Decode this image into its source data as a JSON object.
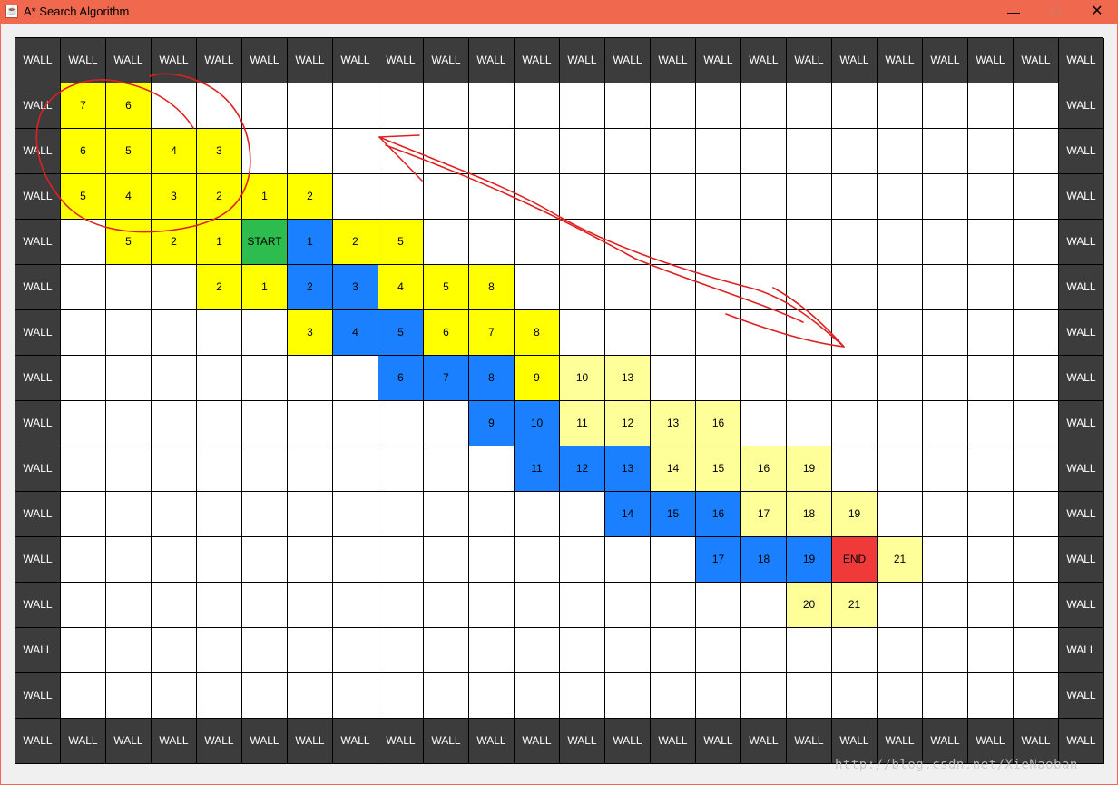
{
  "window": {
    "title": "A* Search Algorithm",
    "minimize_glyph": "—",
    "maximize_glyph": "☐",
    "close_glyph": "✕",
    "app_icon": "java-cup-icon"
  },
  "grid": {
    "cols": 24,
    "rows": 16,
    "wall_label": "WALL",
    "start_label": "START",
    "end_label": "END",
    "legend": {
      "W": "wall",
      "S": "start",
      "E": "end",
      "blue": "path",
      "bright-yellow": "closed",
      "pale-yellow": "open"
    },
    "colors": {
      "wall": "#3c3c3c",
      "empty": "#ffffff",
      "open": "#ffff99",
      "closed": "#ffff00",
      "path": "#1a80ff",
      "start": "#2dbd4e",
      "end": "#f03a3a",
      "annotation": "#e02020"
    },
    "cells": [
      [
        "W",
        "W",
        "W",
        "W",
        "W",
        "W",
        "W",
        "W",
        "W",
        "W",
        "W",
        "W",
        "W",
        "W",
        "W",
        "W",
        "W",
        "W",
        "W",
        "W",
        "W",
        "W",
        "W",
        "W"
      ],
      [
        "W",
        "c:7",
        "c:6",
        "",
        "",
        "",
        "",
        "",
        "",
        "",
        "",
        "",
        "",
        "",
        "",
        "",
        "",
        "",
        "",
        "",
        "",
        "",
        "",
        "W"
      ],
      [
        "W",
        "c:6",
        "c:5",
        "c:4",
        "c:3",
        "",
        "",
        "",
        "",
        "",
        "",
        "",
        "",
        "",
        "",
        "",
        "",
        "",
        "",
        "",
        "",
        "",
        "",
        "W"
      ],
      [
        "W",
        "c:5",
        "c:4",
        "c:3",
        "c:2",
        "c:1",
        "c:2",
        "",
        "",
        "",
        "",
        "",
        "",
        "",
        "",
        "",
        "",
        "",
        "",
        "",
        "",
        "",
        "",
        "W"
      ],
      [
        "W",
        "",
        "c:5",
        "c:2",
        "c:1",
        "S",
        "p:1",
        "c:2",
        "c:5",
        "",
        "",
        "",
        "",
        "",
        "",
        "",
        "",
        "",
        "",
        "",
        "",
        "",
        "",
        "W"
      ],
      [
        "W",
        "",
        "",
        "",
        "c:2",
        "c:1",
        "p:2",
        "p:3",
        "c:4",
        "c:5",
        "c:8",
        "",
        "",
        "",
        "",
        "",
        "",
        "",
        "",
        "",
        "",
        "",
        "",
        "W"
      ],
      [
        "W",
        "",
        "",
        "",
        "",
        "",
        "c:3",
        "p:4",
        "p:5",
        "c:6",
        "c:7",
        "c:8",
        "",
        "",
        "",
        "",
        "",
        "",
        "",
        "",
        "",
        "",
        "",
        "W"
      ],
      [
        "W",
        "",
        "",
        "",
        "",
        "",
        "",
        "",
        "p:6",
        "p:7",
        "p:8",
        "c:9",
        "o:10",
        "o:13",
        "",
        "",
        "",
        "",
        "",
        "",
        "",
        "",
        "",
        "W"
      ],
      [
        "W",
        "",
        "",
        "",
        "",
        "",
        "",
        "",
        "",
        "",
        "p:9",
        "p:10",
        "o:11",
        "o:12",
        "o:13",
        "o:16",
        "",
        "",
        "",
        "",
        "",
        "",
        "",
        "W"
      ],
      [
        "W",
        "",
        "",
        "",
        "",
        "",
        "",
        "",
        "",
        "",
        "",
        "p:11",
        "p:12",
        "p:13",
        "o:14",
        "o:15",
        "o:16",
        "o:19",
        "",
        "",
        "",
        "",
        "",
        "W"
      ],
      [
        "W",
        "",
        "",
        "",
        "",
        "",
        "",
        "",
        "",
        "",
        "",
        "",
        "",
        "p:14",
        "p:15",
        "p:16",
        "o:17",
        "o:18",
        "o:19",
        "",
        "",
        "",
        "",
        "W"
      ],
      [
        "W",
        "",
        "",
        "",
        "",
        "",
        "",
        "",
        "",
        "",
        "",
        "",
        "",
        "",
        "",
        "p:17",
        "p:18",
        "p:19",
        "E",
        "o:21",
        "",
        "",
        "",
        "W"
      ],
      [
        "W",
        "",
        "",
        "",
        "",
        "",
        "",
        "",
        "",
        "",
        "",
        "",
        "",
        "",
        "",
        "",
        "",
        "o:20",
        "o:21",
        "",
        "",
        "",
        "",
        "W"
      ],
      [
        "W",
        "",
        "",
        "",
        "",
        "",
        "",
        "",
        "",
        "",
        "",
        "",
        "",
        "",
        "",
        "",
        "",
        "",
        "",
        "",
        "",
        "",
        "",
        "W"
      ],
      [
        "W",
        "",
        "",
        "",
        "",
        "",
        "",
        "",
        "",
        "",
        "",
        "",
        "",
        "",
        "",
        "",
        "",
        "",
        "",
        "",
        "",
        "",
        "",
        "W"
      ],
      [
        "W",
        "W",
        "W",
        "W",
        "W",
        "W",
        "W",
        "W",
        "W",
        "W",
        "W",
        "W",
        "W",
        "W",
        "W",
        "W",
        "W",
        "W",
        "W",
        "W",
        "W",
        "W",
        "W",
        "W"
      ]
    ]
  },
  "watermark": "http://blog.csdn.net/XieNaoban"
}
